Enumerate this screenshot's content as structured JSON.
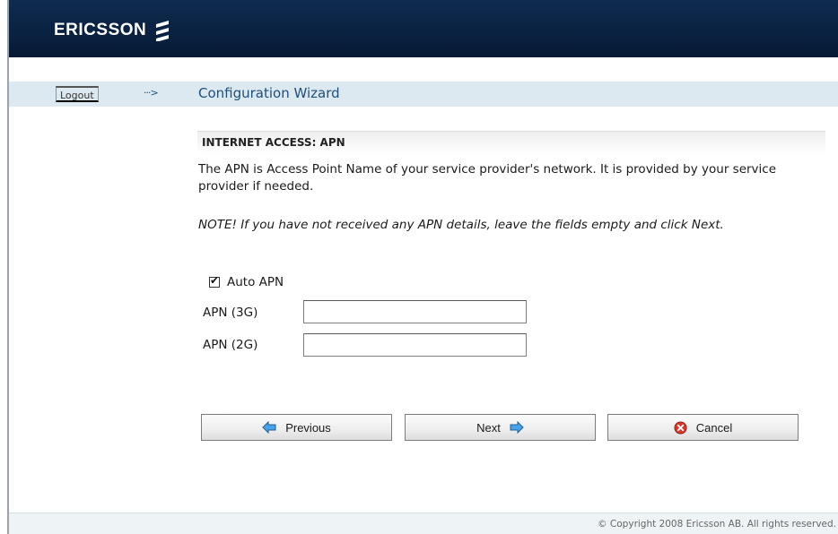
{
  "header": {
    "brand": "ERICSSON",
    "logo_icon": "ericsson-logo-icon"
  },
  "nav": {
    "logout_label": "Logout",
    "arrow_glyph": "···>",
    "title": "Configuration Wizard"
  },
  "section": {
    "title": "INTERNET ACCESS: APN"
  },
  "description": "The APN is Access Point Name of your service provider's network. It is provided by your service provider if needed.",
  "note": "NOTE! If you have not received any APN details, leave the fields empty and click Next.",
  "form": {
    "auto_apn": {
      "label": "Auto APN",
      "checked": true
    },
    "apn_3g": {
      "label": "APN (3G)",
      "value": ""
    },
    "apn_2g": {
      "label": "APN (2G)",
      "value": ""
    }
  },
  "buttons": {
    "previous": {
      "label": "Previous",
      "icon": "arrow-left-icon"
    },
    "next": {
      "label": "Next",
      "icon": "arrow-right-icon"
    },
    "cancel": {
      "label": "Cancel",
      "icon": "cancel-icon"
    }
  },
  "footer": {
    "copyright": "© Copyright 2008 Ericsson AB. All rights reserved."
  },
  "colors": {
    "header_bg": "#0a2242",
    "nav_bg": "#dde9f0",
    "title_blue": "#1f4f7a",
    "cancel_red": "#d9352b",
    "arrow_blue": "#2f7fc7"
  }
}
